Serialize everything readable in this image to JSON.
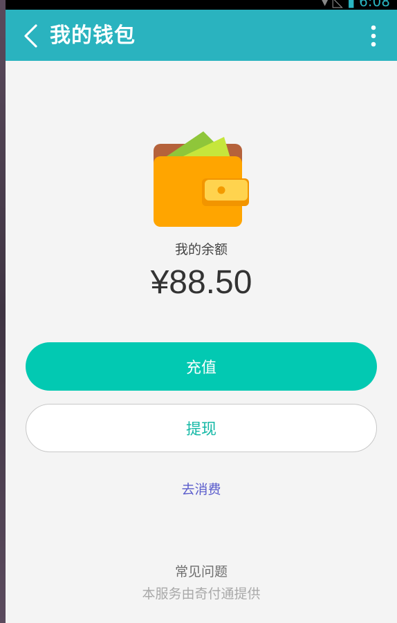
{
  "status_bar": {
    "time": "6:08",
    "icons": [
      "signal-icon",
      "battery-icon"
    ]
  },
  "app_bar": {
    "title": "我的钱包",
    "back_icon": "chevron-left-icon",
    "more_icon": "more-vert-icon",
    "background": "#2ab3bf"
  },
  "wallet": {
    "icon": "wallet-icon",
    "balance_label": "我的余额",
    "balance_amount": "¥88.50"
  },
  "actions": {
    "recharge_label": "充值",
    "withdraw_label": "提现",
    "consume_label": "去消费",
    "recharge_color": "#02c9b2"
  },
  "footer": {
    "faq_label": "常见问题",
    "provider_text": "本服务由奇付通提供"
  }
}
